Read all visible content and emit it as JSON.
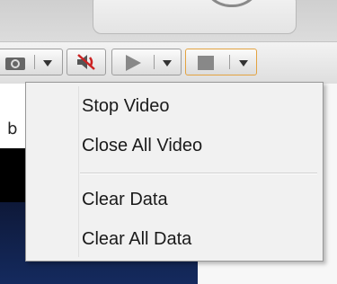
{
  "background_text": {
    "partial_label": "b"
  },
  "toolbar": {
    "buttons": [
      {
        "name": "camera",
        "icon": "camera-icon"
      },
      {
        "name": "mute",
        "icon": "speaker-muted-icon"
      },
      {
        "name": "play",
        "icon": "play-icon"
      },
      {
        "name": "stop",
        "icon": "stop-icon"
      }
    ]
  },
  "menu": {
    "items": [
      {
        "label": "Stop Video"
      },
      {
        "label": "Close All Video"
      },
      {
        "label": "Clear Data"
      },
      {
        "label": "Clear All Data"
      }
    ]
  },
  "colors": {
    "active_border": "#e3a341",
    "mute_icon": "#cc2222",
    "video_bg": "#142a5e"
  }
}
